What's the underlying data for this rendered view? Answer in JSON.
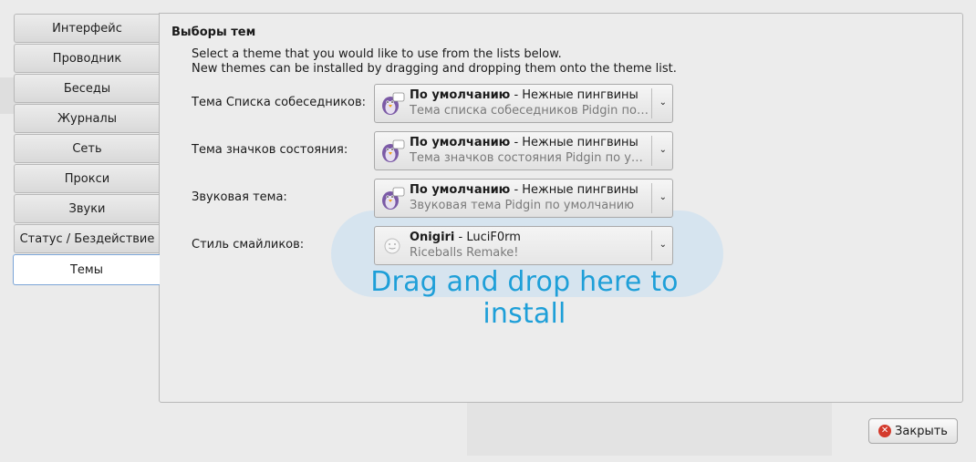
{
  "tabs": [
    {
      "label": "Интерфейс"
    },
    {
      "label": "Проводник"
    },
    {
      "label": "Беседы"
    },
    {
      "label": "Журналы"
    },
    {
      "label": "Сеть"
    },
    {
      "label": "Прокси"
    },
    {
      "label": "Звуки"
    },
    {
      "label": "Статус / Бездействие"
    },
    {
      "label": "Темы",
      "active": true
    }
  ],
  "themes": {
    "title": "Выборы тем",
    "desc_line1": "Select a theme that you would like to use from the lists below.",
    "desc_line2": "New themes can be installed by dragging and dropping them onto the theme list.",
    "rows": [
      {
        "label": "Тема Списка собеседников:",
        "name": "По умолчанию",
        "author": " - Нежные пингвины",
        "description": "Тема списка собеседников Pidgin по…",
        "icon": "pidgin-penguin-icon"
      },
      {
        "label": "Тема значков состояния:",
        "name": "По умолчанию",
        "author": " - Нежные пингвины",
        "description": "Тема значков состояния Pidgin по у…",
        "icon": "pidgin-penguin-icon"
      },
      {
        "label": "Звуковая тема:",
        "name": "По умолчанию",
        "author": " - Нежные пингвины",
        "description": "Звуковая тема Pidgin по умолчанию",
        "icon": "pidgin-penguin-icon"
      },
      {
        "label": "Стиль смайликов:",
        "name": "Onigiri",
        "author": " - LuciF0rm",
        "description": "Riceballs Remake!",
        "icon": "smiley-icon"
      }
    ],
    "drop_hint": "Drag and drop here to install"
  },
  "footer": {
    "close_label": "Закрыть",
    "close_icon": "close-icon"
  },
  "colors": {
    "accent": "#1e9fd8",
    "dropzone": "#cfe2f0",
    "close_icon": "#d43a2c"
  }
}
